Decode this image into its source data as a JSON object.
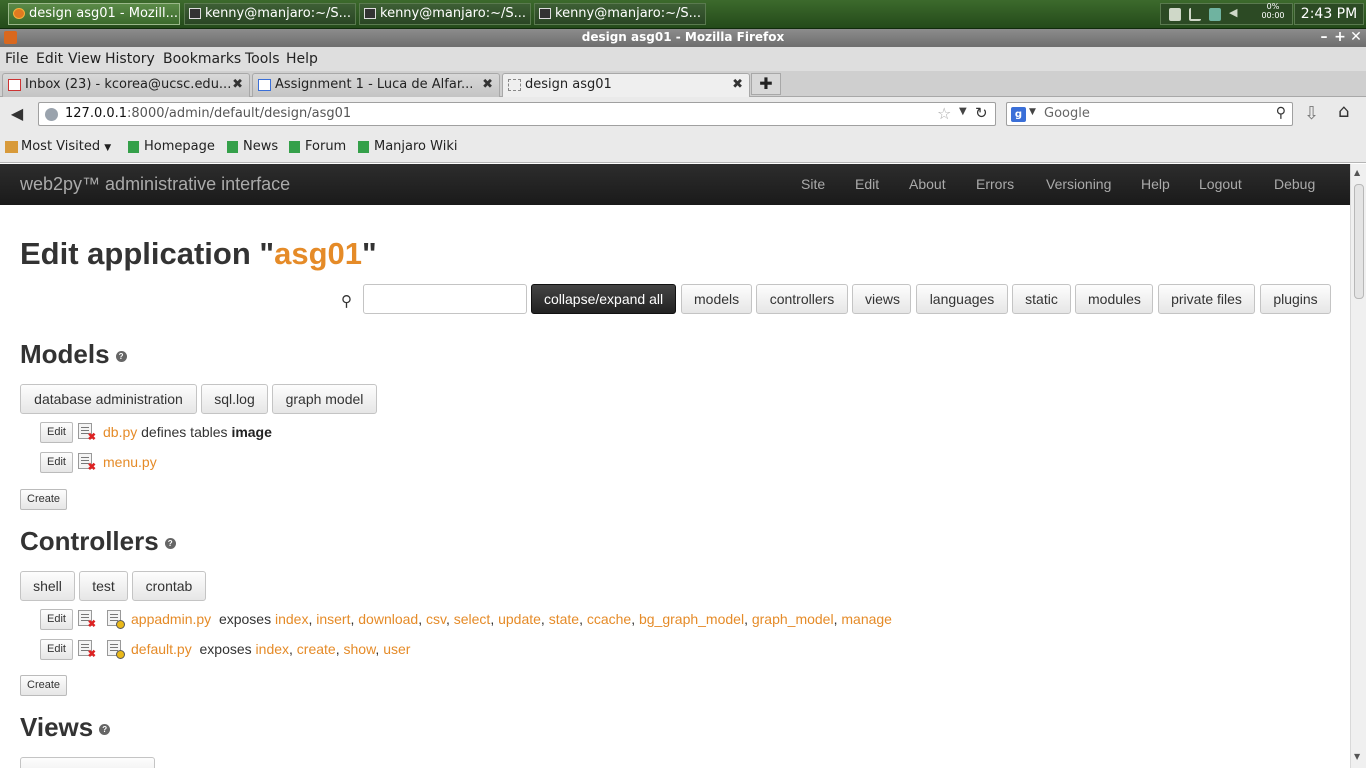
{
  "taskbar": {
    "tasks": [
      "design asg01 - Mozill...",
      "kenny@manjaro:~/S...",
      "kenny@manjaro:~/S...",
      "kenny@manjaro:~/S..."
    ],
    "cpu_percent": "0%",
    "cpu_time": "00:00",
    "clock": "2:43 PM"
  },
  "window": {
    "title": "design asg01 - Mozilla Firefox",
    "minimize": "–",
    "maximize": "+",
    "close": "✕"
  },
  "menubar": [
    "File",
    "Edit",
    "View",
    "History",
    "Bookmarks",
    "Tools",
    "Help"
  ],
  "tabs": [
    {
      "label": "Inbox (23) - kcorea@ucsc.edu...",
      "close": "✖"
    },
    {
      "label": "Assignment 1 - Luca de Alfar...",
      "close": "✖"
    },
    {
      "label": "design asg01",
      "close": "✖"
    }
  ],
  "new_tab": "✚",
  "navbar": {
    "url_host": "127.0.0.1",
    "url_rest": ":8000/admin/default/design/asg01",
    "search_placeholder": "Google"
  },
  "bookmarks": [
    "Most Visited",
    "Homepage",
    "News",
    "Forum",
    "Manjaro Wiki"
  ],
  "site": {
    "brand": "web2py™ administrative interface",
    "nav": [
      "Site",
      "Edit",
      "About",
      "Errors",
      "Versioning",
      "Help",
      "Logout",
      "Debug"
    ]
  },
  "page": {
    "title_prefix": "Edit application \"",
    "app_name": "asg01",
    "title_suffix": "\"",
    "toolbar": [
      "collapse/expand all",
      "models",
      "controllers",
      "views",
      "languages",
      "static",
      "modules",
      "private files",
      "plugins"
    ],
    "models": {
      "heading": "Models",
      "buttons": [
        "database administration",
        "sql.log",
        "graph model"
      ],
      "files": [
        {
          "edit": "Edit",
          "name": "db.py",
          "desc": "defines tables",
          "tables": "image"
        },
        {
          "edit": "Edit",
          "name": "menu.py"
        }
      ],
      "create": "Create"
    },
    "controllers": {
      "heading": "Controllers",
      "buttons": [
        "shell",
        "test",
        "crontab"
      ],
      "files": [
        {
          "edit": "Edit",
          "name": "appadmin.py",
          "exposes_label": "exposes",
          "functions": [
            "index",
            "insert",
            "download",
            "csv",
            "select",
            "update",
            "state",
            "ccache",
            "bg_graph_model",
            "graph_model",
            "manage"
          ]
        },
        {
          "edit": "Edit",
          "name": "default.py",
          "exposes_label": "exposes",
          "functions": [
            "index",
            "create",
            "show",
            "user"
          ]
        }
      ],
      "create": "Create"
    },
    "views": {
      "heading": "Views"
    }
  },
  "colors": {
    "accent": "#e58b28",
    "navbar": "#1f1f1f",
    "taskbar": "#2f5a23"
  }
}
